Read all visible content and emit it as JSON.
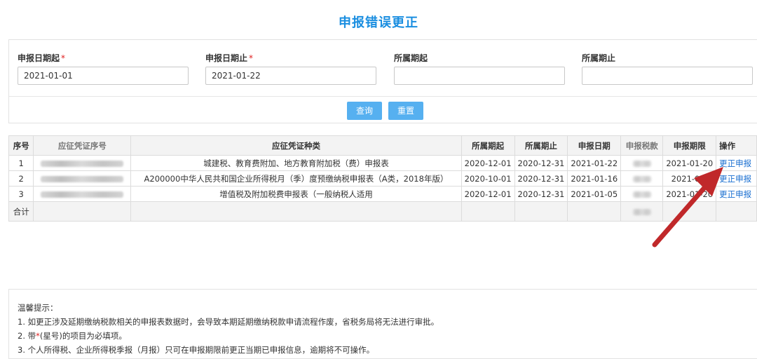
{
  "page": {
    "title": "申报错误更正"
  },
  "form": {
    "start_label": "申报日期起",
    "end_label": "申报日期止",
    "required_mark": "*",
    "start_value": "2021-01-01",
    "end_value": "2021-01-22",
    "period_start_label": "所属期起",
    "period_end_label": "所属期止",
    "period_start_value": "",
    "period_end_value": "",
    "query_label": "查询",
    "reset_label": "重置"
  },
  "table": {
    "headers": [
      "序号",
      "应征凭证序号",
      "应征凭证种类",
      "所属期起",
      "所属期止",
      "申报日期",
      "申报税款",
      "申报期限",
      "操作"
    ],
    "rows": [
      {
        "no": "1",
        "type": "城建税、教育费附加、地方教育附加税（费）申报表",
        "period_start": "2020-12-01",
        "period_end": "2020-12-31",
        "declare_date": "2021-01-22",
        "deadline": "2021-01-20",
        "action": "更正申报"
      },
      {
        "no": "2",
        "type": "A200000中华人民共和国企业所得税月（季）度预缴纳税申报表（A类，2018年版）",
        "period_start": "2020-10-01",
        "period_end": "2020-12-31",
        "declare_date": "2021-01-16",
        "deadline": "2021-01-",
        "action": "更正申报"
      },
      {
        "no": "3",
        "type": "增值税及附加税费申报表（一般纳税人适用",
        "period_start": "2020-12-01",
        "period_end": "2020-12-31",
        "declare_date": "2021-01-05",
        "deadline": "2021-01-20",
        "action": "更正申报"
      }
    ],
    "sum_label": "合计"
  },
  "tips": {
    "heading": "温馨提示：",
    "line1": "1. 如更正涉及延期缴纳税款相关的申报表数据时，会导致本期延期缴纳税款申请流程作废，省税务局将无法进行审批。",
    "line2_prefix": "2. 带",
    "line2_mark": "*",
    "line2_suffix": "(星号)的项目为必填项。",
    "line3": "3. 个人所得税、企业所得税季报（月报）只可在申报期限前更正当期已申报信息，逾期将不可操作。"
  },
  "colors": {
    "accent": "#1a8ee0",
    "button": "#56b0f0",
    "link": "#1a6fd0",
    "arrow": "#c0282a",
    "required": "#e02020"
  }
}
